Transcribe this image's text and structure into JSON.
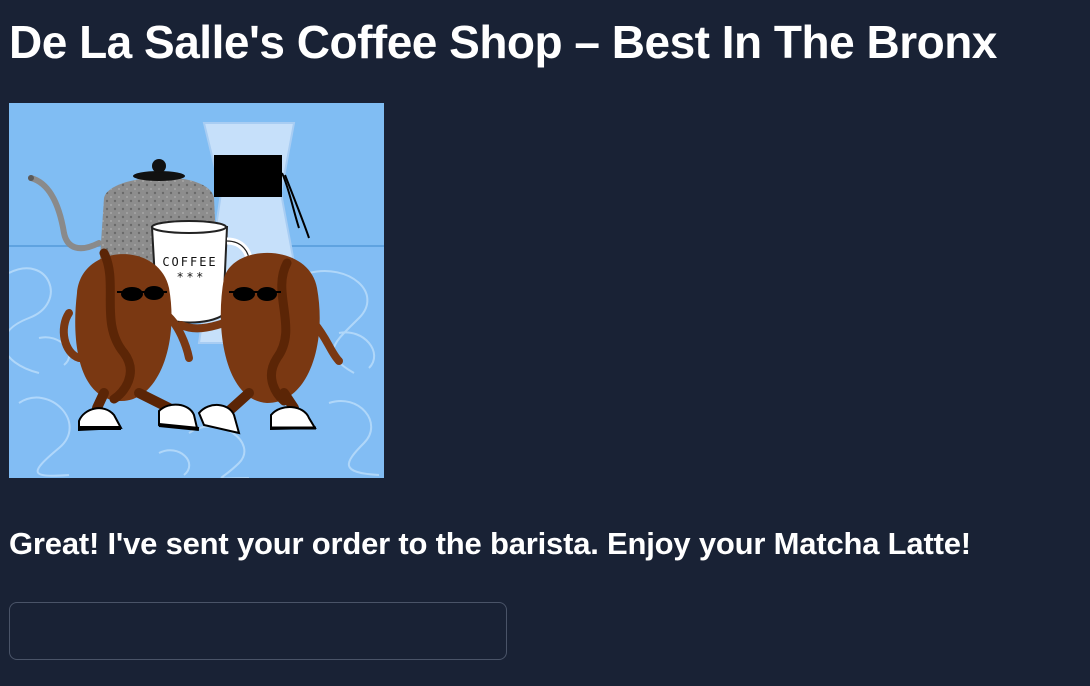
{
  "header": {
    "title": "De La Salle's Coffee Shop – Best In The Bronx"
  },
  "illustration": {
    "mug_text": "COFFEE",
    "mug_stars": "* * *"
  },
  "chat": {
    "message": "Great! I've sent your order to the barista. Enjoy your Matcha Latte!"
  },
  "input": {
    "value": "",
    "placeholder": ""
  },
  "colors": {
    "background": "#192235",
    "text": "#ffffff",
    "input_border": "#4a5468",
    "illustration_sky": "#7dbbf2",
    "bean_brown": "#7a3812"
  }
}
